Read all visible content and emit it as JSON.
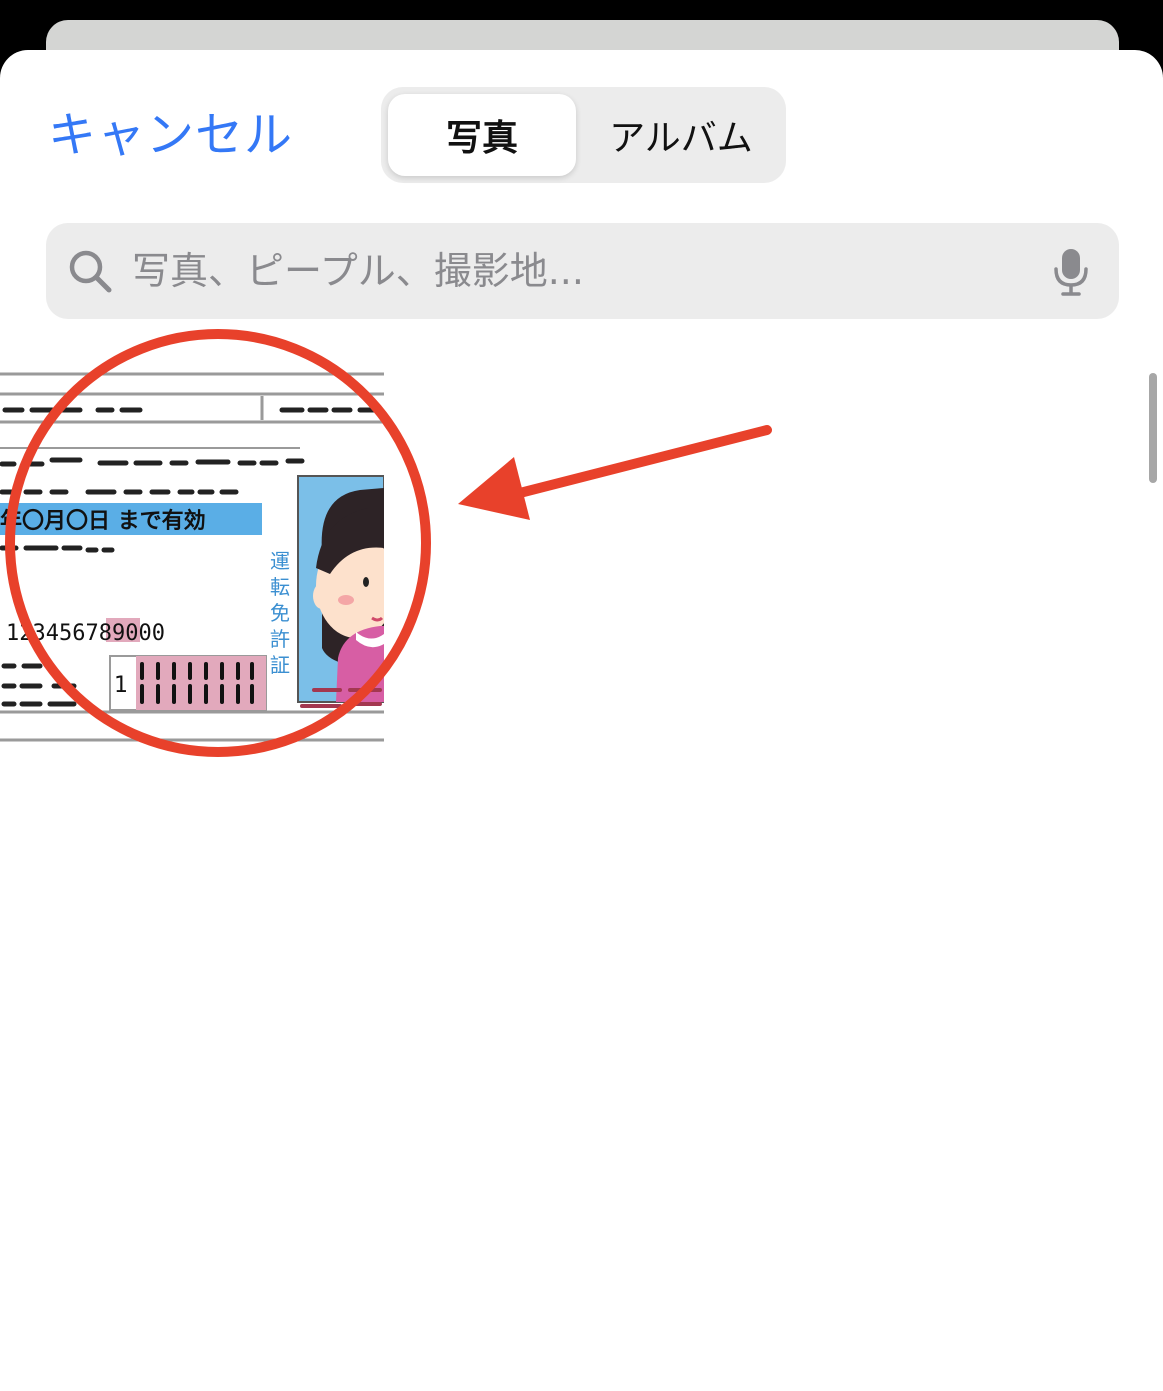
{
  "header": {
    "cancel_label": "キャンセル",
    "tabs": [
      {
        "label": "写真",
        "selected": true
      },
      {
        "label": "アルバム",
        "selected": false
      }
    ]
  },
  "search": {
    "placeholder": "写真、ピープル、撮影地...",
    "value": ""
  },
  "photo_thumbnail": {
    "card_text": {
      "expiry": "年〇月〇日 まで有効",
      "number": "123456789000",
      "side_label": [
        "運",
        "転",
        "免",
        "許",
        "証"
      ],
      "small_box_digit": "1"
    }
  },
  "colors": {
    "accent": "#3478f6",
    "annotation": "#e8412b",
    "card_blue": "#5aaee6",
    "card_pink": "#e2a9bc"
  },
  "icons": [
    "search-icon",
    "microphone-icon"
  ]
}
